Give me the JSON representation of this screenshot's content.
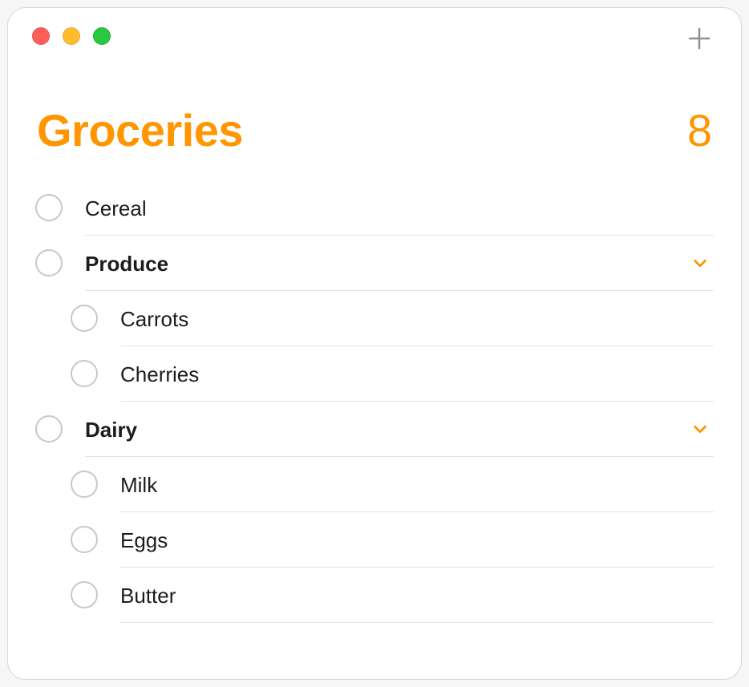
{
  "accent_color": "#FF9500",
  "header": {
    "title": "Groceries",
    "count": "8"
  },
  "list": {
    "items": [
      {
        "label": "Cereal",
        "bold": false,
        "indent": 0,
        "chevron": false,
        "divider": "l1"
      },
      {
        "label": "Produce",
        "bold": true,
        "indent": 0,
        "chevron": true,
        "divider": "l1"
      },
      {
        "label": "Carrots",
        "bold": false,
        "indent": 1,
        "chevron": false,
        "divider": "l2"
      },
      {
        "label": "Cherries",
        "bold": false,
        "indent": 1,
        "chevron": false,
        "divider": "l2"
      },
      {
        "label": "Dairy",
        "bold": true,
        "indent": 0,
        "chevron": true,
        "divider": "l1"
      },
      {
        "label": "Milk",
        "bold": false,
        "indent": 1,
        "chevron": false,
        "divider": "l2"
      },
      {
        "label": "Eggs",
        "bold": false,
        "indent": 1,
        "chevron": false,
        "divider": "l2"
      },
      {
        "label": "Butter",
        "bold": false,
        "indent": 1,
        "chevron": false,
        "divider": "l2"
      }
    ]
  }
}
